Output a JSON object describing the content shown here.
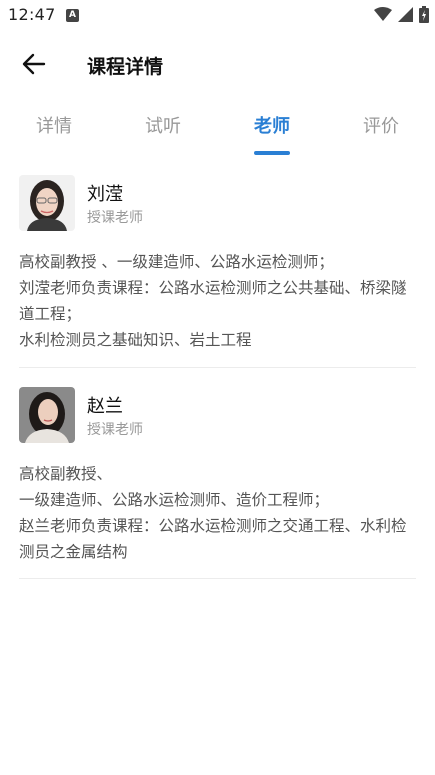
{
  "status_bar": {
    "time": "12:47",
    "notif_letter": "A"
  },
  "header": {
    "title": "课程详情"
  },
  "tabs": [
    {
      "label": "详情"
    },
    {
      "label": "试听"
    },
    {
      "label": "老师"
    },
    {
      "label": "评价"
    }
  ],
  "active_tab": "老师",
  "teachers": [
    {
      "name": "刘滢",
      "role": "授课老师",
      "bio": [
        "高校副教授 、一级建造师、公路水运检测师；",
        "刘滢老师负责课程：公路水运检测师之公共基础、桥梁隧道工程；",
        "水利检测员之基础知识、岩土工程"
      ]
    },
    {
      "name": "赵兰",
      "role": "授课老师",
      "bio": [
        "高校副教授、",
        "一级建造师、公路水运检测师、造价工程师；",
        "赵兰老师负责课程：公路水运检测师之交通工程、水利检测员之金属结构"
      ]
    }
  ],
  "colors": {
    "accent": "#2a7fd4",
    "tab_inactive": "#999999",
    "bio_text": "#555555"
  }
}
